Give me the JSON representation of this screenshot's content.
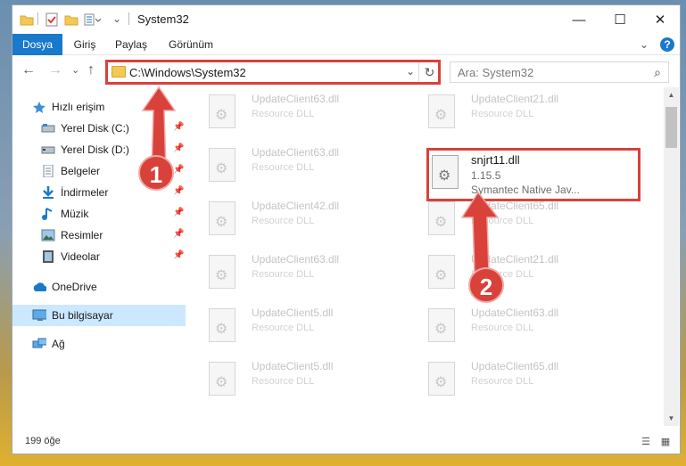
{
  "window": {
    "title": "System32",
    "controls": {
      "minimize": "—",
      "maximize": "☐",
      "close": "✕"
    }
  },
  "ribbon": {
    "tabs": [
      "Dosya",
      "Giriş",
      "Paylaş",
      "Görünüm"
    ],
    "expand": "⌄",
    "help": "?"
  },
  "nav": {
    "back": "←",
    "forward": "→",
    "recent": "⌄",
    "up": "↑",
    "address": "C:\\Windows\\System32",
    "address_chevron": "⌄",
    "refresh": "↻",
    "search_placeholder": "Ara: System32",
    "search_icon": "⌕"
  },
  "sidebar": {
    "items": [
      {
        "label": "Hızlı erişim",
        "icon": "star-icon",
        "pinned": false
      },
      {
        "label": "Yerel Disk (C:)",
        "icon": "drive-icon",
        "pinned": true
      },
      {
        "label": "Yerel Disk (D:)",
        "icon": "drive-icon",
        "pinned": true
      },
      {
        "label": "Belgeler",
        "icon": "documents-icon",
        "pinned": true
      },
      {
        "label": "İndirmeler",
        "icon": "download-icon",
        "pinned": true
      },
      {
        "label": "Müzik",
        "icon": "music-icon",
        "pinned": true
      },
      {
        "label": "Resimler",
        "icon": "pictures-icon",
        "pinned": true
      },
      {
        "label": "Videolar",
        "icon": "video-icon",
        "pinned": true
      },
      {
        "label": "OneDrive",
        "icon": "cloud-icon",
        "pinned": false
      },
      {
        "label": "Bu bilgisayar",
        "icon": "computer-icon",
        "pinned": false
      },
      {
        "label": "Ağ",
        "icon": "network-icon",
        "pinned": false
      }
    ],
    "pin_glyph": "📌"
  },
  "files": [
    {
      "name": "UpdateClient63.dll",
      "desc": "Resource DLL"
    },
    {
      "name": "UpdateClient21.dll",
      "desc": "Resource DLL"
    },
    {
      "name": "UpdateClient63.dll",
      "desc": "Resource DLL"
    },
    {
      "name": "snjrt11.dll",
      "desc": "1.15.5",
      "desc2": "Symantec Native Jav...",
      "highlight": true
    },
    {
      "name": "UpdateClient42.dll",
      "desc": "Resource DLL"
    },
    {
      "name": "UpdateClient65.dll",
      "desc": "Resource DLL"
    },
    {
      "name": "UpdateClient63.dll",
      "desc": "Resource DLL"
    },
    {
      "name": "UpdateClient21.dll",
      "desc": "Resource DLL"
    },
    {
      "name": "UpdateClient5.dll",
      "desc": "Resource DLL"
    },
    {
      "name": "UpdateClient63.dll",
      "desc": "Resource DLL"
    },
    {
      "name": "UpdateClient5.dll",
      "desc": "Resource DLL"
    },
    {
      "name": "UpdateClient65.dll",
      "desc": "Resource DLL"
    }
  ],
  "status": {
    "count": "199 öğe",
    "details_view": "☰",
    "tiles_view": "▦"
  },
  "annotations": {
    "one": "1",
    "two": "2"
  },
  "colors": {
    "accent": "#1979ca",
    "annotation": "#d9413b",
    "selected": "#cce8ff"
  }
}
